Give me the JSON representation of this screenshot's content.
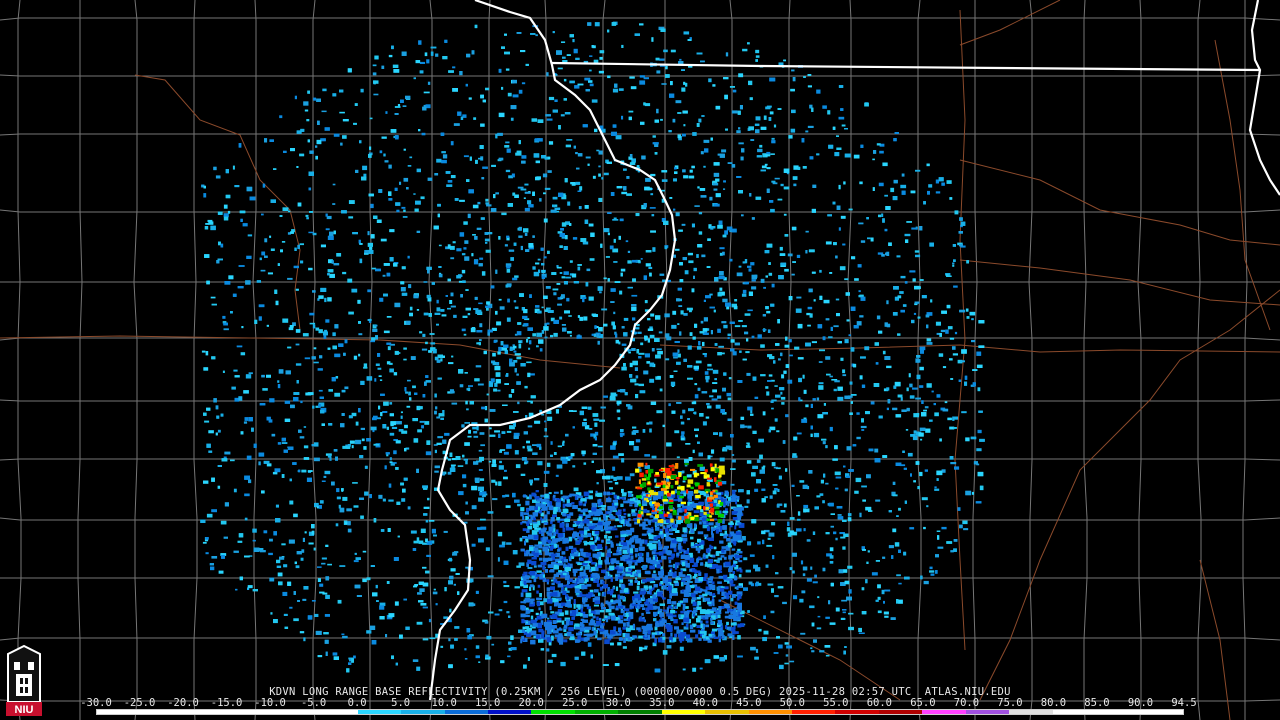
{
  "map": {
    "radar_site": "KDVN",
    "product": "LONG RANGE BASE REFLECTIVITY",
    "resolution": "(0.25KM / 256 LEVEL)",
    "volume_info": "(000000/0000 0.5 DEG)",
    "timestamp": "2025-11-28 02:57 UTC",
    "source": "ATLAS.NIU.EDU",
    "caption": "KDVN LONG RANGE BASE REFLECTIVITY (0.25KM / 256 LEVEL) (000000/0000 0.5 DEG) 2025-11-28 02:57 UTC  ATLAS.NIU.EDU",
    "logo_text": "NIU",
    "colors": {
      "background": "#000000",
      "state_border": "#ffffff",
      "county_border": "#7a7a7a",
      "highway": "#8b4a2b"
    }
  },
  "legend": {
    "ticks": [
      "-30.0",
      "-25.0",
      "-20.0",
      "-15.0",
      "-10.0",
      "-5.0",
      "0.0",
      "5.0",
      "10.0",
      "15.0",
      "20.0",
      "25.0",
      "30.0",
      "35.0",
      "40.0",
      "45.0",
      "50.0",
      "55.0",
      "60.0",
      "65.0",
      "70.0",
      "75.0",
      "80.0",
      "85.0",
      "90.0",
      "94.5"
    ],
    "colors": [
      "#ffffff",
      "#ffffff",
      "#ffffff",
      "#ffffff",
      "#ffffff",
      "#ffffff",
      "#2ad6ff",
      "#18b0e8",
      "#0a6cd8",
      "#0010c8",
      "#00e000",
      "#00b000",
      "#008000",
      "#ffff00",
      "#e8c000",
      "#ff9000",
      "#ff2000",
      "#d00000",
      "#b00000",
      "#ff40ff",
      "#a050e0",
      "#e0e0e0",
      "#ffffff",
      "#ffffff",
      "#ffffff"
    ]
  }
}
